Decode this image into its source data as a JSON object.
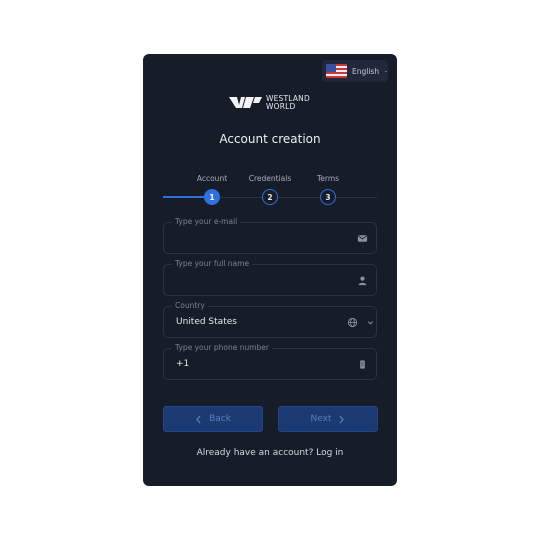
{
  "language": {
    "label": "English",
    "flag_icon": "us-flag-icon"
  },
  "brand": {
    "line1": "WESTLAND",
    "line2": "WORLD"
  },
  "page": {
    "title": "Account creation"
  },
  "steps": [
    {
      "label": "Account",
      "number": "1",
      "state": "active"
    },
    {
      "label": "Credentials",
      "number": "2",
      "state": "todo"
    },
    {
      "label": "Terms",
      "number": "3",
      "state": "todo"
    }
  ],
  "fields": {
    "email": {
      "label": "Type your e-mail",
      "value": "",
      "icon": "envelope-icon"
    },
    "name": {
      "label": "Type your full name",
      "value": "",
      "icon": "user-icon"
    },
    "country": {
      "label": "Country",
      "value": "United States",
      "icon": "globe-icon"
    },
    "phone": {
      "label": "Type your phone number",
      "value": "+1",
      "icon": "phone-icon"
    }
  },
  "buttons": {
    "back": "Back",
    "next": "Next"
  },
  "footer": {
    "text": "Already have an account?",
    "login": "Log in"
  },
  "colors": {
    "card": "#171c29",
    "accent": "#2f6fe0",
    "button": "#1b3a72"
  }
}
